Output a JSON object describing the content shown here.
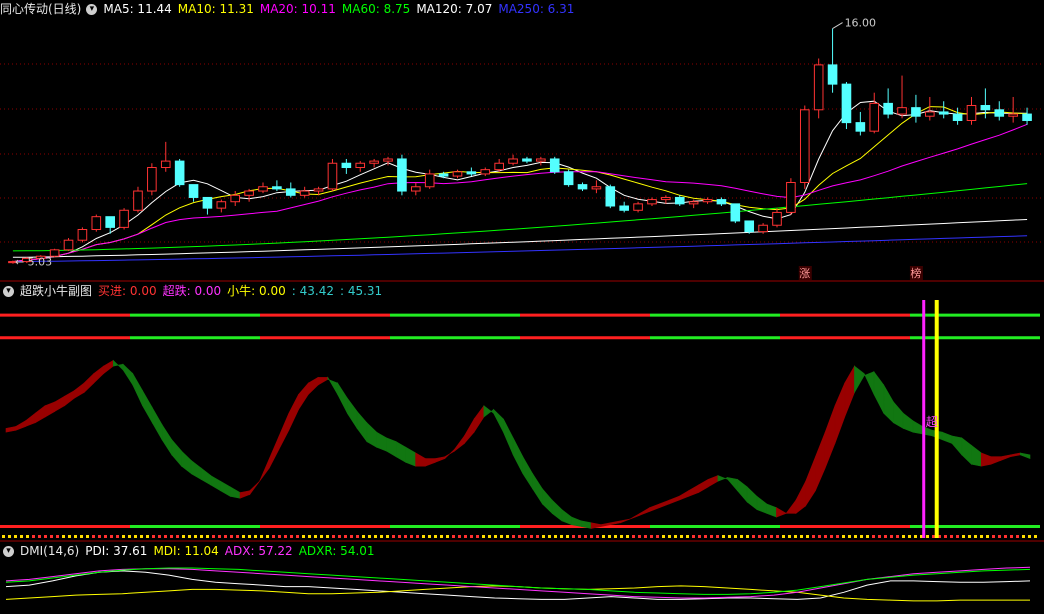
{
  "main_panel": {
    "title": "同心传动(日线)",
    "ma_items": [
      {
        "label": "MA5: 11.44",
        "color": "#ffffff"
      },
      {
        "label": "MA10: 11.31",
        "color": "#ffff00"
      },
      {
        "label": "MA20: 10.11",
        "color": "#ff00ff"
      },
      {
        "label": "MA60: 8.75",
        "color": "#00ff00"
      },
      {
        "label": "MA120: 7.07",
        "color": "#ffffff"
      },
      {
        "label": "MA250: 6.31",
        "color": "#3333ff"
      }
    ],
    "high_label": "16.00",
    "low_label": "5.03",
    "tags": [
      "涨",
      "榜"
    ]
  },
  "sub_panel": {
    "title": "超跌小牛副图",
    "items": [
      {
        "label": "买进: 0.00",
        "color": "#ff3333"
      },
      {
        "label": "超跌: 0.00",
        "color": "#ff33ff"
      },
      {
        "label": "小牛: 0.00",
        "color": "#ffff00"
      },
      {
        "label": ": 43.42",
        "color": "#33cccc"
      },
      {
        "label": ": 45.31",
        "color": "#33cccc"
      }
    ],
    "marker_text": "超"
  },
  "dmi_panel": {
    "title": "DMI(14,6)",
    "items": [
      {
        "label": "PDI: 37.61",
        "color": "#ffffff"
      },
      {
        "label": "MDI: 11.04",
        "color": "#ffff00"
      },
      {
        "label": "ADX: 57.22",
        "color": "#ff33ff"
      },
      {
        "label": "ADXR: 54.01",
        "color": "#00ff00"
      }
    ]
  },
  "chart_data": [
    {
      "type": "candlestick",
      "ylim": [
        4.8,
        16.4
      ],
      "up_color": "#ff3333",
      "down_color": "#54ffff",
      "candles": [
        [
          5.05,
          5.15,
          5.0,
          5.1
        ],
        [
          5.1,
          5.3,
          5.03,
          5.25
        ],
        [
          5.25,
          5.4,
          5.2,
          5.35
        ],
        [
          5.35,
          5.7,
          5.3,
          5.65
        ],
        [
          5.65,
          6.2,
          5.6,
          6.1
        ],
        [
          6.1,
          6.7,
          6.0,
          6.6
        ],
        [
          6.6,
          7.3,
          6.5,
          7.2
        ],
        [
          7.2,
          7.2,
          6.4,
          6.7
        ],
        [
          6.7,
          7.6,
          6.6,
          7.5
        ],
        [
          7.5,
          8.6,
          7.4,
          8.4
        ],
        [
          8.4,
          9.7,
          8.2,
          9.5
        ],
        [
          9.5,
          10.7,
          9.3,
          9.8
        ],
        [
          9.8,
          9.9,
          8.6,
          8.7
        ],
        [
          8.7,
          8.7,
          7.9,
          8.1
        ],
        [
          8.1,
          8.1,
          7.3,
          7.6
        ],
        [
          7.6,
          8.0,
          7.4,
          7.9
        ],
        [
          7.9,
          8.4,
          7.7,
          8.2
        ],
        [
          8.2,
          8.5,
          7.9,
          8.4
        ],
        [
          8.4,
          8.8,
          8.3,
          8.6
        ],
        [
          8.6,
          8.9,
          8.4,
          8.5
        ],
        [
          8.5,
          8.8,
          8.1,
          8.2
        ],
        [
          8.2,
          8.6,
          8.1,
          8.4
        ],
        [
          8.4,
          8.6,
          8.2,
          8.5
        ],
        [
          8.5,
          9.9,
          8.4,
          9.7
        ],
        [
          9.7,
          9.9,
          9.2,
          9.5
        ],
        [
          9.5,
          9.8,
          9.3,
          9.7
        ],
        [
          9.7,
          9.9,
          9.5,
          9.8
        ],
        [
          9.8,
          10.0,
          9.6,
          9.9
        ],
        [
          9.9,
          10.1,
          8.2,
          8.4
        ],
        [
          8.4,
          8.8,
          8.2,
          8.6
        ],
        [
          8.6,
          9.4,
          8.5,
          9.2
        ],
        [
          9.2,
          9.3,
          9.0,
          9.1
        ],
        [
          9.1,
          9.4,
          9.0,
          9.3
        ],
        [
          9.3,
          9.5,
          9.1,
          9.2
        ],
        [
          9.2,
          9.5,
          9.1,
          9.4
        ],
        [
          9.4,
          9.9,
          9.3,
          9.7
        ],
        [
          9.7,
          10.1,
          9.6,
          9.9
        ],
        [
          9.9,
          10.0,
          9.7,
          9.8
        ],
        [
          9.8,
          10.0,
          9.6,
          9.9
        ],
        [
          9.9,
          10.0,
          9.2,
          9.3
        ],
        [
          9.3,
          9.4,
          8.6,
          8.7
        ],
        [
          8.7,
          8.8,
          8.4,
          8.5
        ],
        [
          8.5,
          8.9,
          8.3,
          8.6
        ],
        [
          8.6,
          8.7,
          7.6,
          7.7
        ],
        [
          7.7,
          7.9,
          7.4,
          7.5
        ],
        [
          7.5,
          7.9,
          7.4,
          7.8
        ],
        [
          7.8,
          8.1,
          7.7,
          8.0
        ],
        [
          8.0,
          8.2,
          7.8,
          8.1
        ],
        [
          8.1,
          8.2,
          7.7,
          7.8
        ],
        [
          7.8,
          8.0,
          7.6,
          7.9
        ],
        [
          7.9,
          8.1,
          7.8,
          8.0
        ],
        [
          8.0,
          8.1,
          7.7,
          7.8
        ],
        [
          7.8,
          7.8,
          6.9,
          7.0
        ],
        [
          7.0,
          7.0,
          6.4,
          6.5
        ],
        [
          6.5,
          6.9,
          6.4,
          6.8
        ],
        [
          6.8,
          7.6,
          6.7,
          7.4
        ],
        [
          7.4,
          9.0,
          7.3,
          8.8
        ],
        [
          8.8,
          12.4,
          8.5,
          12.2
        ],
        [
          12.2,
          14.6,
          11.8,
          14.3
        ],
        [
          14.3,
          16.0,
          13.0,
          13.4
        ],
        [
          13.4,
          13.5,
          11.3,
          11.6
        ],
        [
          11.6,
          12.1,
          11.0,
          11.2
        ],
        [
          11.2,
          13.0,
          11.1,
          12.5
        ],
        [
          12.5,
          13.2,
          11.8,
          12.0
        ],
        [
          12.0,
          13.8,
          11.8,
          12.3
        ],
        [
          12.3,
          12.9,
          11.6,
          11.9
        ],
        [
          11.9,
          12.8,
          11.7,
          12.1
        ],
        [
          12.1,
          12.6,
          11.8,
          12.0
        ],
        [
          12.0,
          12.3,
          11.5,
          11.7
        ],
        [
          11.7,
          12.8,
          11.5,
          12.4
        ],
        [
          12.4,
          13.2,
          11.8,
          12.2
        ],
        [
          12.2,
          12.6,
          11.7,
          11.9
        ],
        [
          11.9,
          12.8,
          11.6,
          12.0
        ],
        [
          12.0,
          12.3,
          11.5,
          11.7
        ]
      ]
    },
    {
      "type": "area",
      "ylim": [
        -5,
        120
      ],
      "bands": [
        0,
        100
      ],
      "upper_band": 112,
      "series": [
        {
          "name": "",
          "values": [
            52,
            53,
            56,
            60,
            64,
            66,
            69,
            72,
            76,
            81,
            85,
            88,
            83,
            75,
            64,
            55,
            46,
            38,
            32,
            28,
            25,
            22,
            19,
            16,
            15,
            17,
            24,
            36,
            48,
            60,
            70,
            76,
            79,
            79,
            70,
            60,
            52,
            45,
            42,
            40,
            37,
            34,
            32,
            32,
            34,
            36,
            41,
            48,
            57,
            64,
            60,
            50,
            38,
            28,
            20,
            12,
            7,
            3,
            1,
            0,
            -1,
            0,
            1,
            2,
            4,
            7,
            10,
            12,
            14,
            16,
            19,
            22,
            25,
            27,
            25,
            19,
            13,
            9,
            7,
            5,
            7,
            14,
            24,
            37,
            50,
            64,
            76,
            85,
            81,
            70,
            60,
            55,
            52,
            50,
            49,
            48,
            46,
            44,
            38,
            33,
            32,
            33,
            35,
            37,
            38,
            36
          ]
        },
        {
          "name": "",
          "values": [
            50,
            51,
            53,
            55,
            58,
            61,
            64,
            68,
            71,
            76,
            81,
            85,
            86,
            81,
            72,
            63,
            54,
            46,
            40,
            35,
            31,
            27,
            24,
            21,
            18,
            19,
            24,
            31,
            41,
            51,
            62,
            70,
            75,
            78,
            76,
            68,
            61,
            55,
            50,
            47,
            45,
            42,
            39,
            36,
            36,
            37,
            40,
            44,
            50,
            58,
            62,
            57,
            47,
            37,
            28,
            20,
            14,
            9,
            5,
            3,
            2,
            1,
            2,
            3,
            4,
            6,
            8,
            10,
            12,
            14,
            16,
            18,
            21,
            24,
            26,
            25,
            21,
            16,
            12,
            10,
            7,
            7,
            11,
            19,
            31,
            44,
            58,
            71,
            80,
            82,
            75,
            66,
            60,
            56,
            53,
            51,
            50,
            48,
            47,
            43,
            39,
            37,
            37,
            38,
            39,
            38
          ]
        }
      ],
      "cyan_marker_index": 94
    },
    {
      "type": "line",
      "ylim": [
        0,
        70
      ],
      "series": [
        {
          "name": "PDI",
          "values": [
            30,
            32,
            38,
            45,
            50,
            52,
            50,
            46,
            40,
            36,
            34,
            32,
            30,
            30,
            28,
            26,
            24,
            22,
            20,
            18,
            16,
            14,
            13,
            12,
            12,
            14,
            16,
            14,
            12,
            12,
            13,
            14,
            14,
            13,
            12,
            14,
            22,
            32,
            38,
            38,
            37,
            36,
            36,
            37,
            38
          ]
        },
        {
          "name": "MDI",
          "values": [
            12,
            14,
            16,
            18,
            19,
            20,
            22,
            24,
            26,
            26,
            25,
            24,
            22,
            20,
            20,
            21,
            22,
            24,
            26,
            28,
            30,
            31,
            30,
            28,
            27,
            26,
            27,
            28,
            30,
            31,
            30,
            28,
            26,
            24,
            22,
            18,
            14,
            12,
            11,
            10,
            10,
            11,
            11,
            11,
            11
          ]
        },
        {
          "name": "ADX",
          "values": [
            38,
            40,
            44,
            48,
            52,
            54,
            55,
            55,
            54,
            52,
            50,
            48,
            46,
            44,
            42,
            40,
            38,
            36,
            34,
            32,
            30,
            28,
            26,
            24,
            22,
            20,
            18,
            16,
            15,
            14,
            14,
            15,
            16,
            18,
            22,
            28,
            34,
            40,
            44,
            48,
            50,
            52,
            54,
            56,
            57
          ]
        },
        {
          "name": "ADXR",
          "values": [
            36,
            38,
            42,
            46,
            50,
            53,
            55,
            56,
            56,
            55,
            54,
            52,
            50,
            48,
            46,
            44,
            42,
            40,
            38,
            36,
            34,
            32,
            30,
            28,
            27,
            26,
            24,
            22,
            21,
            20,
            19,
            19,
            20,
            22,
            25,
            30,
            35,
            40,
            43,
            46,
            48,
            50,
            52,
            53,
            54
          ]
        }
      ]
    }
  ]
}
